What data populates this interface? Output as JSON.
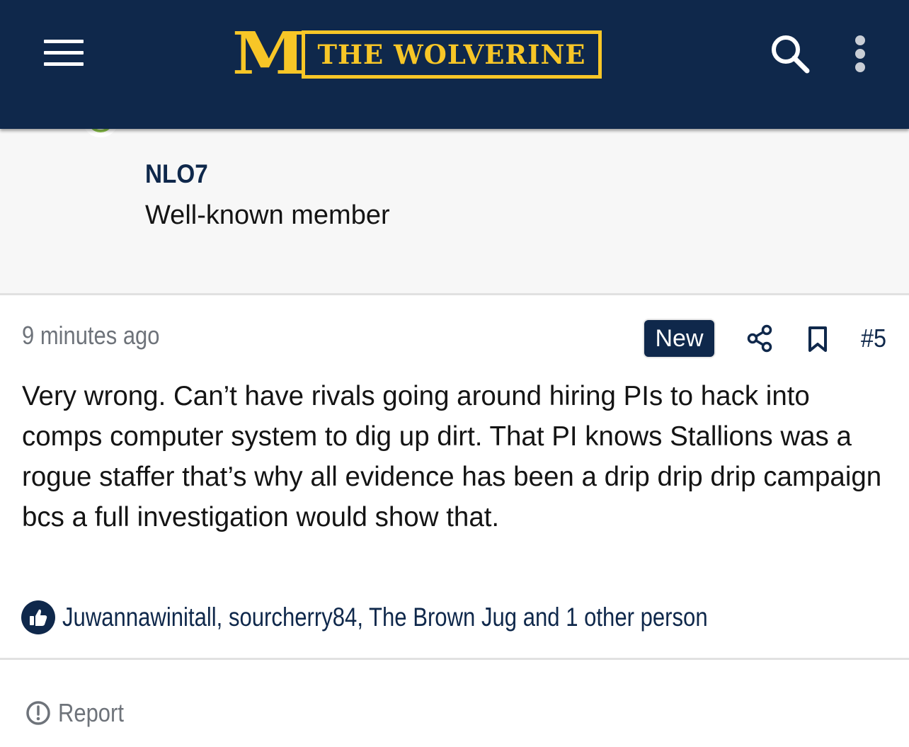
{
  "header": {
    "logo_letter": "M",
    "logo_text": "THE WOLVERINE",
    "menu_icon": "hamburger-menu-icon",
    "search_icon": "search-icon",
    "more_icon": "vertical-ellipsis-icon"
  },
  "author": {
    "username": "NLO7",
    "user_title": "Well-known member",
    "status_icon": "online-user-icon"
  },
  "post": {
    "timestamp": "9 minutes ago",
    "new_badge": "New",
    "share_icon": "share-icon",
    "bookmark_icon": "bookmark-icon",
    "post_number": "#5",
    "body": "Very wrong. Can’t have rivals going around hiring PIs to hack into comps computer system to dig up dirt. That PI knows Stallions was a rogue staffer that’s why all evidence has been a drip drip drip campaign bcs a full investigation would show that.",
    "reactions_icon": "thumbs-up-icon",
    "reactions_text": "Juwannawinitall, sourcherry84, The Brown Jug and 1 other person"
  },
  "footer": {
    "report_icon": "exclamation-circle-icon",
    "report_label": "Report"
  },
  "colors": {
    "navy": "#0f284b",
    "maize": "#f7c627",
    "online_green": "#8bc34a",
    "muted_gray": "#6e737a"
  }
}
